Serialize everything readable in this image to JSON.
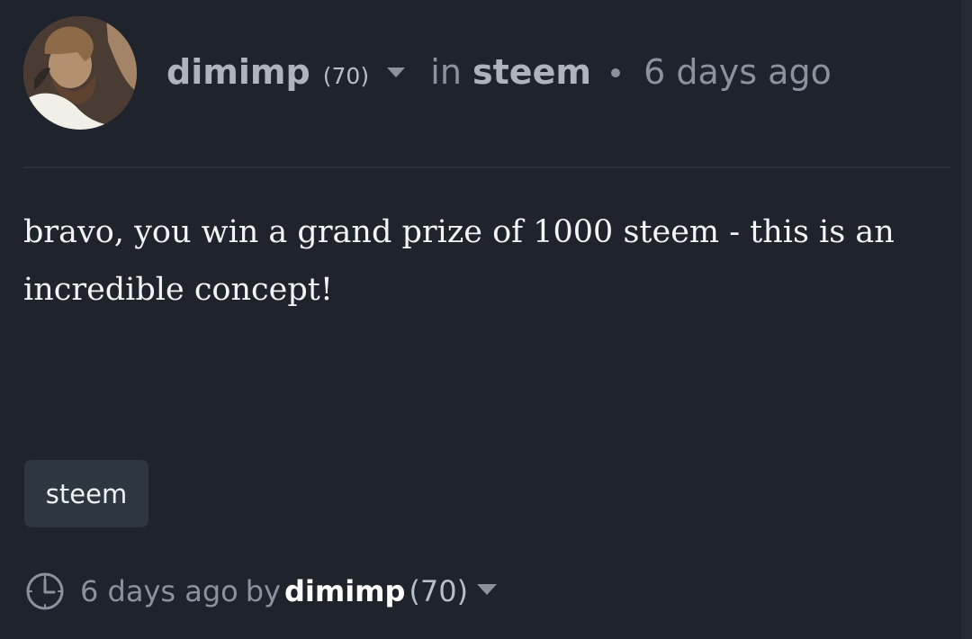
{
  "comment": {
    "author": "dimimp",
    "reputation": "(70)",
    "in_label": "in",
    "community": "steem",
    "timestamp": "6 days ago",
    "body": "bravo, you win a grand prize of 1000 steem - this is an incredible concept!",
    "tags": [
      "steem"
    ],
    "footer": {
      "timestamp": "6 days ago",
      "by_label": "by",
      "author": "dimimp",
      "reputation": "(70)"
    }
  },
  "icons": {
    "avatar": "avatar",
    "caret": "chevron-down-icon",
    "clock": "clock-icon"
  },
  "colors": {
    "background": "#1f232b",
    "tag_bg": "#2e3640",
    "muted_text": "#8b929b",
    "body_text": "#f2f4f6"
  }
}
